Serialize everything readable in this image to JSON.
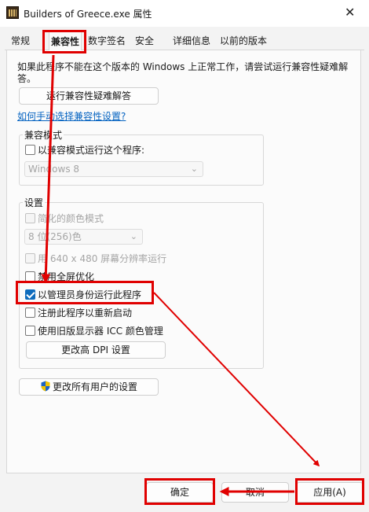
{
  "window": {
    "title": "Builders of Greece.exe 属性",
    "close_glyph": "✕"
  },
  "tabs": [
    "常规",
    "兼容性",
    "数字签名",
    "安全",
    "详细信息",
    "以前的版本"
  ],
  "intro_text": "如果此程序不能在这个版本的 Windows 上正常工作，请尝试运行兼容性疑难解答。",
  "troubleshooter_button": "运行兼容性疑难解答",
  "manual_link": "如何手动选择兼容性设置?",
  "compat_mode": {
    "group_label": "兼容模式",
    "checkbox_label": "以兼容模式运行这个程序:",
    "checkbox_checked": false,
    "os_value": "Windows 8"
  },
  "settings": {
    "group_label": "设置",
    "reduced_color_label": "简化的颜色模式",
    "color_value": "8 位(256)色",
    "resolution_label": "用 640 x 480 屏幕分辨率运行",
    "fullscreen_label": "禁用全屏优化",
    "admin_label": "以管理员身份运行此程序",
    "admin_checked": true,
    "restart_label": "注册此程序以重新启动",
    "icc_label": "使用旧版显示器 ICC 颜色管理",
    "dpi_button": "更改高 DPI 设置"
  },
  "all_users_button": "更改所有用户的设置",
  "footer": {
    "ok": "确定",
    "cancel": "取消",
    "apply": "应用(A)"
  },
  "colors": {
    "annotation_red": "#e00000",
    "accent": "#0f6cbd",
    "link": "#0563c1"
  }
}
